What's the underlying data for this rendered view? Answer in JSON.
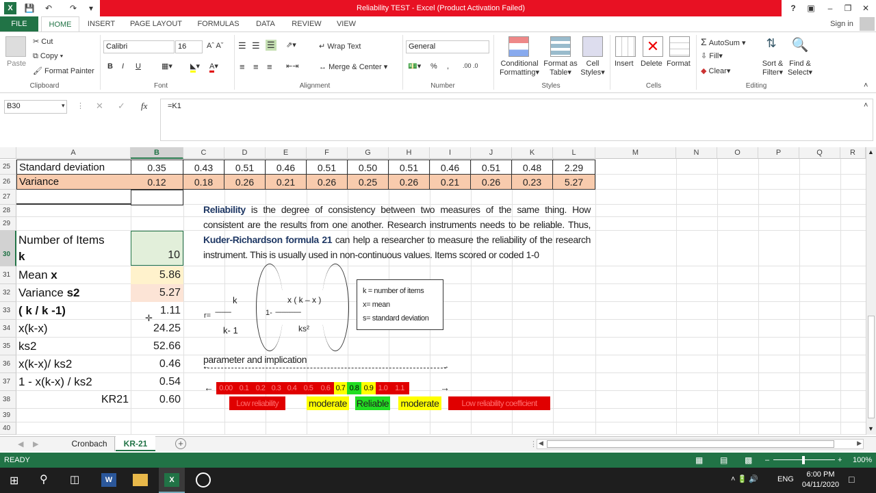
{
  "window": {
    "title": "Reliability TEST -  Excel (Product Activation Failed)",
    "help": "?",
    "signin": "Sign in"
  },
  "tabs": [
    "FILE",
    "HOME",
    "INSERT",
    "PAGE LAYOUT",
    "FORMULAS",
    "DATA",
    "REVIEW",
    "VIEW"
  ],
  "ribbon": {
    "clipboard": {
      "paste": "Paste",
      "cut": "Cut",
      "copy": "Copy",
      "format_painter": "Format Painter",
      "group": "Clipboard"
    },
    "font": {
      "name": "Calibri",
      "size": "16",
      "bold": "B",
      "italic": "I",
      "underline": "U",
      "group": "Font"
    },
    "alignment": {
      "wrap": "Wrap Text",
      "merge": "Merge & Center",
      "group": "Alignment"
    },
    "number": {
      "format": "General",
      "percent": "%",
      "comma": ",",
      "group": "Number"
    },
    "styles": {
      "conditional": "Conditional",
      "conditional2": "Formatting",
      "format_as": "Format as",
      "format_as2": "Table",
      "cell": "Cell",
      "cell2": "Styles",
      "group": "Styles"
    },
    "cells": {
      "insert": "Insert",
      "delete": "Delete",
      "format": "Format",
      "group": "Cells"
    },
    "editing": {
      "autosum": "AutoSum",
      "fill": "Fill",
      "clear": "Clear",
      "sort": "Sort &",
      "sort2": "Filter",
      "find": "Find &",
      "find2": "Select",
      "group": "Editing"
    }
  },
  "formula_bar": {
    "name_box": "B30",
    "fx": "fx",
    "formula": "=K1"
  },
  "columns": [
    "A",
    "B",
    "C",
    "D",
    "E",
    "F",
    "G",
    "H",
    "I",
    "J",
    "K",
    "L",
    "M",
    "N",
    "O",
    "P",
    "Q",
    "R"
  ],
  "rows": {
    "r25": {
      "num": "25",
      "label": "Standard deviation",
      "values": [
        "0.35",
        "0.43",
        "0.51",
        "0.46",
        "0.51",
        "0.50",
        "0.51",
        "0.46",
        "0.51",
        "0.48",
        "2.29"
      ]
    },
    "r26": {
      "num": "26",
      "label": "Variance",
      "values": [
        "0.12",
        "0.18",
        "0.26",
        "0.21",
        "0.26",
        "0.25",
        "0.26",
        "0.21",
        "0.26",
        "0.23",
        "5.27"
      ]
    },
    "nums": [
      "27",
      "28",
      "29",
      "30",
      "31",
      "32",
      "33",
      "34",
      "35",
      "36",
      "37",
      "38",
      "39",
      "40"
    ]
  },
  "kr21": {
    "items_label1": "Number of Items",
    "items_label2": "k",
    "items_val": "10",
    "mean_label": "Mean ",
    "mean_bold": "x",
    "mean_val": "5.86",
    "var_label": "Variance ",
    "var_bold": "s2",
    "var_val": "5.27",
    "kk_label": "( k / k -1)",
    "kk_val": "1.11",
    "xkx_label": "x(k-x)",
    "xkx_val": "24.25",
    "ks2_label": "ks2",
    "ks2_val": "52.66",
    "ratio_label": "x(k-x)/ ks2",
    "ratio_val": "0.46",
    "one_minus_label": "1 - x(k-x) / ks2",
    "one_minus_val": "0.54",
    "kr21_label": "KR21",
    "kr21_val": "0.60"
  },
  "paragraph": {
    "b1": "Reliability",
    "t1": " is the degree of consistency between two measures of the same thing. How consistent are the results from one another. Research instruments needs to be reliable. Thus, ",
    "b2": "Kuder-Richardson formula 21",
    "t2": " can help a researcher to measure the reliability of the research instrument. This is usually used in non-continuous values. Items scored or coded 1-0"
  },
  "formula": {
    "k_top": "k",
    "dashes": "----------",
    "k_bottom": "k- 1",
    "r": "r=",
    "one": "1-",
    "num": "x ( k – x )",
    "dashes2": "----------------",
    "den": "ks²"
  },
  "legend": {
    "l1": "k = number of items",
    "l2": "x= mean",
    "l3": "s= standard deviation"
  },
  "scale": {
    "title": "parameter and implication",
    "values": [
      "0.00",
      "0.1",
      "0.2",
      "0.3",
      "0.4",
      "0.5",
      "0.6",
      "0.7",
      "0.8",
      "0.9",
      "1.0",
      "1.1"
    ],
    "labels": [
      "Low reliability",
      "moderate",
      "Reliable",
      "moderate",
      "Low reliability coefficient"
    ],
    "colors": {
      "red": "#e00000",
      "yellow": "#ffff00",
      "green": "#22dd22"
    }
  },
  "sheets": [
    "Cronbach",
    "KR-21"
  ],
  "status": {
    "ready": "READY",
    "zoom": "100%"
  },
  "taskbar": {
    "lang": "ENG",
    "time": "6:00 PM",
    "date": "04/11/2020"
  }
}
